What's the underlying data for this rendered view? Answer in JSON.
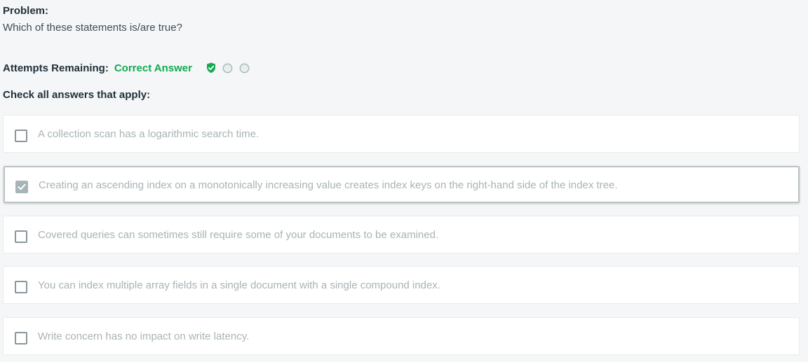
{
  "problem": {
    "heading": "Problem:",
    "question": "Which of these statements is/are true?"
  },
  "attempts": {
    "label": "Attempts Remaining:",
    "status": "Correct Answer",
    "icons": [
      "shield-check-icon",
      "attempt-circle-icon",
      "attempt-circle-icon"
    ]
  },
  "instructions": "Check all answers that apply:",
  "options": [
    {
      "text": "A collection scan has a logarithmic search time.",
      "checked": false
    },
    {
      "text": "Creating an ascending index on a monotonically increasing value creates index keys on the right-hand side of the index tree.",
      "checked": true
    },
    {
      "text": "Covered queries can sometimes still require some of your documents to be examined.",
      "checked": false
    },
    {
      "text": "You can index multiple array fields in a single document with a single compound index.",
      "checked": false
    },
    {
      "text": "Write concern has no impact on write latency.",
      "checked": false
    }
  ],
  "colors": {
    "background": "#f4f6f7",
    "correct": "#13aa52",
    "option_text": "#a9b3b6",
    "checked_box": "#a8b5b8"
  }
}
